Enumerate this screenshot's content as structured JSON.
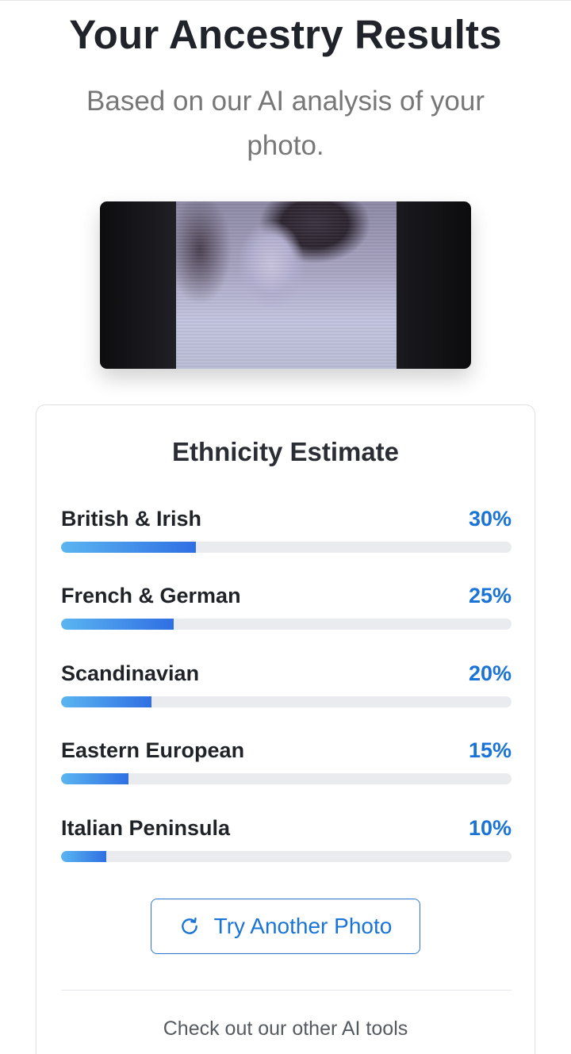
{
  "header": {
    "title": "Your Ancestry Results",
    "subtitle": "Based on our AI analysis of your photo."
  },
  "photo": {
    "alt": "uploaded-portrait"
  },
  "estimate": {
    "title": "Ethnicity Estimate",
    "rows": [
      {
        "label": "British & Irish",
        "percent_text": "30%",
        "percent": 30
      },
      {
        "label": "French & German",
        "percent_text": "25%",
        "percent": 25
      },
      {
        "label": "Scandinavian",
        "percent_text": "20%",
        "percent": 20
      },
      {
        "label": "Eastern European",
        "percent_text": "15%",
        "percent": 15
      },
      {
        "label": "Italian Peninsula",
        "percent_text": "10%",
        "percent": 10
      }
    ],
    "try_button_label": "Try Another Photo",
    "try_button_icon": "refresh-icon",
    "footer_text": "Check out our other AI tools"
  },
  "colors": {
    "accent": "#1a73d6",
    "bar_start": "#5bb5f1",
    "bar_end": "#2f6fe3",
    "track": "#e9ebee"
  }
}
